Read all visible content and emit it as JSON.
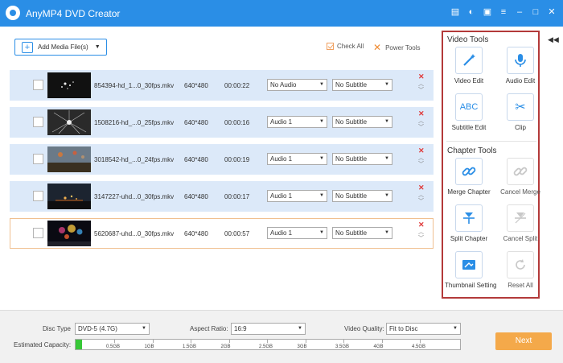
{
  "app": {
    "title": "AnyMP4 DVD Creator",
    "title_icons": [
      "document-icon",
      "chat-icon",
      "feedback-icon",
      "menu-icon",
      "minimize-icon",
      "maximize-icon",
      "close-icon"
    ]
  },
  "toolbar": {
    "add_media_label": "Add Media File(s)",
    "check_all_label": "Check All",
    "power_tools_label": "Power Tools"
  },
  "files": [
    {
      "name": "854394-hd_1...0_30fps.mkv",
      "resolution": "640*480",
      "duration": "00:00:22",
      "audio": "No Audio",
      "subtitle": "No Subtitle"
    },
    {
      "name": "1508216-hd_...0_25fps.mkv",
      "resolution": "640*480",
      "duration": "00:00:16",
      "audio": "Audio 1",
      "subtitle": "No Subtitle"
    },
    {
      "name": "3018542-hd_...0_24fps.mkv",
      "resolution": "640*480",
      "duration": "00:00:19",
      "audio": "Audio 1",
      "subtitle": "No Subtitle"
    },
    {
      "name": "3147227-uhd...0_30fps.mkv",
      "resolution": "640*480",
      "duration": "00:00:17",
      "audio": "Audio 1",
      "subtitle": "No Subtitle"
    },
    {
      "name": "5620687-uhd...0_30fps.mkv",
      "resolution": "640*480",
      "duration": "00:00:57",
      "audio": "Audio 1",
      "subtitle": "No Subtitle"
    }
  ],
  "video_tools": {
    "title": "Video Tools",
    "items": [
      {
        "label": "Video Edit",
        "icon": "magic-wand-icon"
      },
      {
        "label": "Audio Edit",
        "icon": "microphone-icon"
      },
      {
        "label": "Subtitle Edit",
        "icon": "abc-icon",
        "text": "ABC"
      },
      {
        "label": "Clip",
        "icon": "scissors-icon"
      }
    ]
  },
  "chapter_tools": {
    "title": "Chapter Tools",
    "items": [
      {
        "label": "Merge Chapter",
        "icon": "link-icon"
      },
      {
        "label": "Cancel Merge",
        "icon": "unlink-icon"
      },
      {
        "label": "Split Chapter",
        "icon": "split-icon"
      },
      {
        "label": "Cancel Split",
        "icon": "cancel-split-icon"
      },
      {
        "label": "Thumbnail Setting",
        "icon": "thumbnail-icon"
      },
      {
        "label": "Reset All",
        "icon": "reset-icon"
      }
    ]
  },
  "settings": {
    "disc_type_label": "Disc Type",
    "disc_type_value": "DVD-5 (4.7G)",
    "aspect_ratio_label": "Aspect Ratio:",
    "aspect_ratio_value": "16:9",
    "video_quality_label": "Video Quality:",
    "video_quality_value": "Fit to Disc",
    "capacity_label": "Estimated Capacity:",
    "capacity_ticks": [
      "0.5GB",
      "1GB",
      "1.5GB",
      "2GB",
      "2.5GB",
      "3GB",
      "3.5GB",
      "4GB",
      "4.5GB"
    ],
    "capacity_used_fraction": 0.017
  },
  "next_label": "Next",
  "colors": {
    "accent": "#2a8ee6",
    "next_button": "#f4a94a",
    "highlight_border": "#b33a3a",
    "capacity_fill": "#38c838"
  }
}
